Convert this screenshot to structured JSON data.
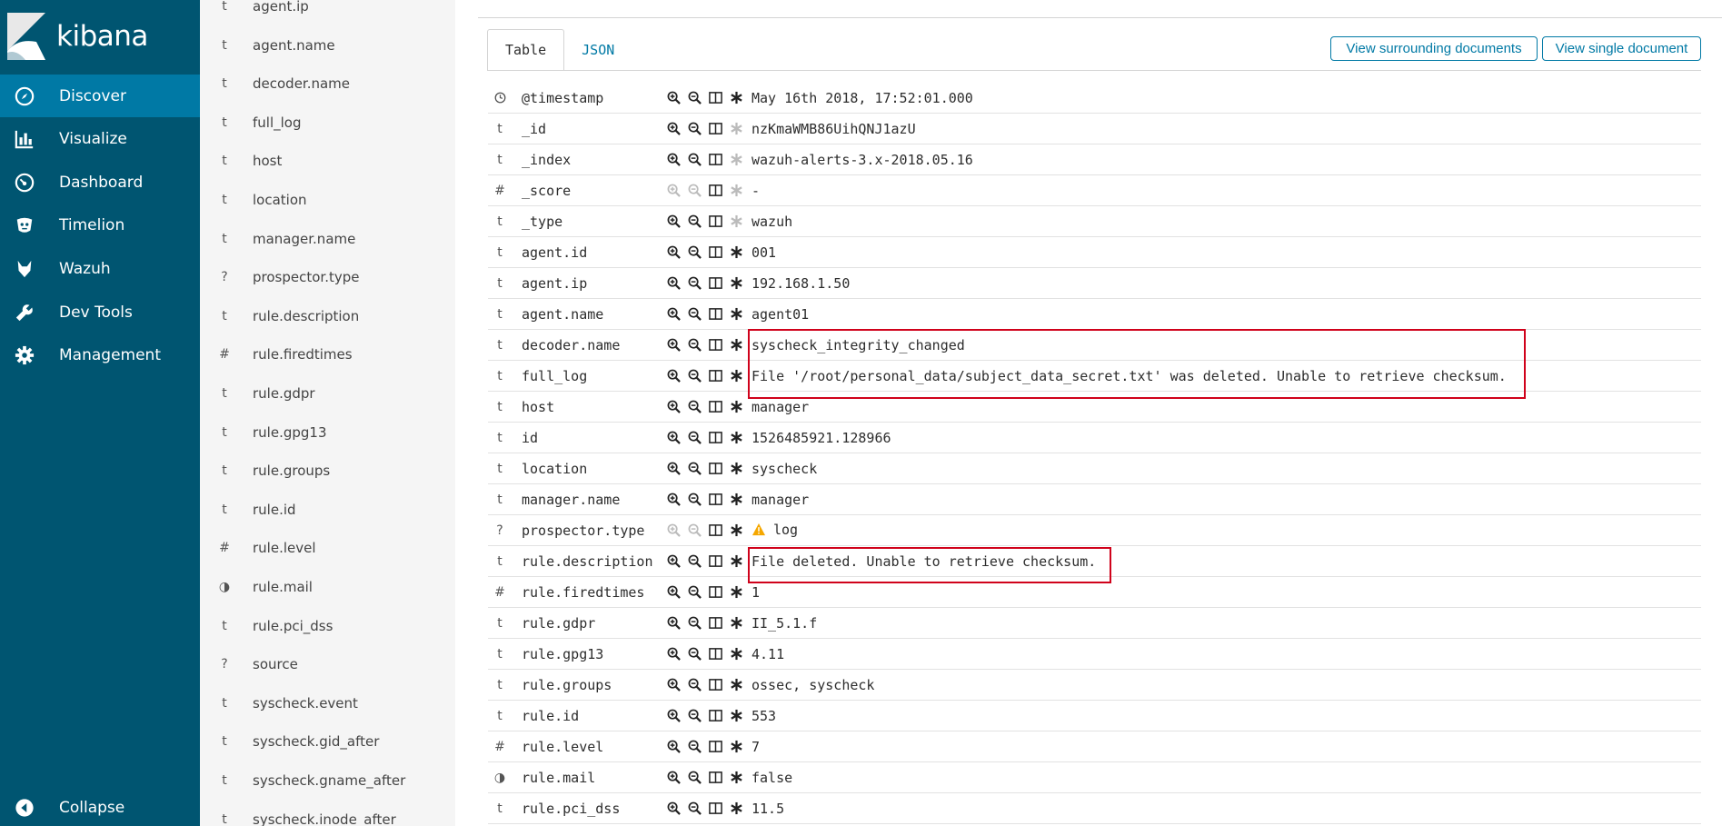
{
  "app": {
    "name": "kibana"
  },
  "nav": {
    "items": [
      {
        "label": "Discover",
        "icon": "compass-icon"
      },
      {
        "label": "Visualize",
        "icon": "bar-chart-icon"
      },
      {
        "label": "Dashboard",
        "icon": "gauge-icon"
      },
      {
        "label": "Timelion",
        "icon": "timelion-icon"
      },
      {
        "label": "Wazuh",
        "icon": "wazuh-icon"
      },
      {
        "label": "Dev Tools",
        "icon": "wrench-icon"
      },
      {
        "label": "Management",
        "icon": "gear-icon"
      }
    ],
    "collapse_label": "Collapse",
    "active": "Discover"
  },
  "fields": [
    {
      "type": "t",
      "name": "agent.ip"
    },
    {
      "type": "t",
      "name": "agent.name"
    },
    {
      "type": "t",
      "name": "decoder.name"
    },
    {
      "type": "t",
      "name": "full_log"
    },
    {
      "type": "t",
      "name": "host"
    },
    {
      "type": "t",
      "name": "location"
    },
    {
      "type": "t",
      "name": "manager.name"
    },
    {
      "type": "?",
      "name": "prospector.type"
    },
    {
      "type": "t",
      "name": "rule.description"
    },
    {
      "type": "#",
      "name": "rule.firedtimes"
    },
    {
      "type": "t",
      "name": "rule.gdpr"
    },
    {
      "type": "t",
      "name": "rule.gpg13"
    },
    {
      "type": "t",
      "name": "rule.groups"
    },
    {
      "type": "t",
      "name": "rule.id"
    },
    {
      "type": "#",
      "name": "rule.level"
    },
    {
      "type": "◑",
      "name": "rule.mail"
    },
    {
      "type": "t",
      "name": "rule.pci_dss"
    },
    {
      "type": "?",
      "name": "source"
    },
    {
      "type": "t",
      "name": "syscheck.event"
    },
    {
      "type": "t",
      "name": "syscheck.gid_after"
    },
    {
      "type": "t",
      "name": "syscheck.gname_after"
    },
    {
      "type": "t",
      "name": "syscheck.inode_after"
    }
  ],
  "doc": {
    "tabs": [
      "Table",
      "JSON"
    ],
    "active_tab": "Table",
    "buttons": {
      "surrounding": "View surrounding documents",
      "single": "View single document"
    },
    "rows": [
      {
        "type": "clock",
        "name": "@timestamp",
        "value": "May 16th 2018, 17:52:01.000",
        "dim": false
      },
      {
        "type": "t",
        "name": "_id",
        "value": "nzKmaWMB86UihQNJ1azU",
        "dim": false,
        "star_dim": true
      },
      {
        "type": "t",
        "name": "_index",
        "value": "wazuh-alerts-3.x-2018.05.16",
        "dim": false,
        "star_dim": true
      },
      {
        "type": "#",
        "name": "_score",
        "value": " -",
        "dim": true,
        "star_dim": true
      },
      {
        "type": "t",
        "name": "_type",
        "value": "wazuh",
        "dim": false,
        "star_dim": true
      },
      {
        "type": "t",
        "name": "agent.id",
        "value": "001",
        "dim": false
      },
      {
        "type": "t",
        "name": "agent.ip",
        "value": "192.168.1.50",
        "dim": false
      },
      {
        "type": "t",
        "name": "agent.name",
        "value": "agent01",
        "dim": false
      },
      {
        "type": "t",
        "name": "decoder.name",
        "value": "syscheck_integrity_changed",
        "dim": false
      },
      {
        "type": "t",
        "name": "full_log",
        "value": "File '/root/personal_data/subject_data_secret.txt' was deleted. Unable to retrieve checksum.",
        "dim": false
      },
      {
        "type": "t",
        "name": "host",
        "value": "manager",
        "dim": false
      },
      {
        "type": "t",
        "name": "id",
        "value": "1526485921.128966",
        "dim": false
      },
      {
        "type": "t",
        "name": "location",
        "value": "syscheck",
        "dim": false
      },
      {
        "type": "t",
        "name": "manager.name",
        "value": "manager",
        "dim": false
      },
      {
        "type": "?",
        "name": "prospector.type",
        "value": "log",
        "dim": true,
        "warning": true
      },
      {
        "type": "t",
        "name": "rule.description",
        "value": "File deleted. Unable to retrieve checksum.",
        "dim": false
      },
      {
        "type": "#",
        "name": "rule.firedtimes",
        "value": "1",
        "dim": false
      },
      {
        "type": "t",
        "name": "rule.gdpr",
        "value": "II_5.1.f",
        "dim": false
      },
      {
        "type": "t",
        "name": "rule.gpg13",
        "value": "4.11",
        "dim": false
      },
      {
        "type": "t",
        "name": "rule.groups",
        "value": "ossec, syscheck",
        "dim": false
      },
      {
        "type": "t",
        "name": "rule.id",
        "value": "553",
        "dim": false
      },
      {
        "type": "#",
        "name": "rule.level",
        "value": "7",
        "dim": false
      },
      {
        "type": "◑",
        "name": "rule.mail",
        "value": "false",
        "dim": false
      },
      {
        "type": "t",
        "name": "rule.pci_dss",
        "value": "11.5",
        "dim": false
      }
    ]
  },
  "colors": {
    "nav_bg": "#005571",
    "nav_active": "#0079a5",
    "link": "#0079a5",
    "highlight": "#d0021b",
    "warning": "#f5a700"
  }
}
